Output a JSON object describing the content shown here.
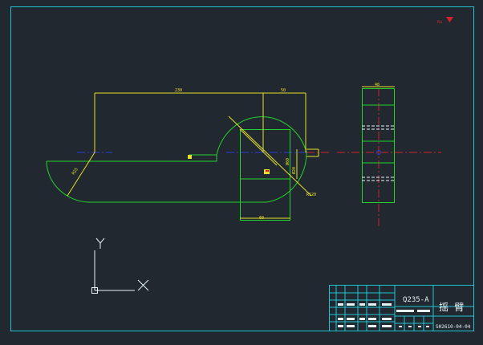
{
  "drawing": {
    "material": "Q235-A",
    "part_name": "摇 臂",
    "drawing_number": "SH2610-04-04",
    "corner_mark": "Ra"
  },
  "dimensions": {
    "overall_length": "230",
    "center_offset": "50",
    "side_width": "48",
    "bore": "Ø60",
    "radius": "R25",
    "vertical": "Ø20",
    "fillet": "R120",
    "bottom": "60"
  },
  "ucs": {
    "x_label": "X",
    "y_label": "Y"
  },
  "colors": {
    "background": "#212830",
    "border": "#1fc4d2",
    "outline": "#22d32b",
    "dimension": "#e8e02a",
    "hidden": "#e6f4f6",
    "centerline_red": "#d2212a",
    "centerline_blue": "#2a3cd6",
    "ucs": "#e6f4f6"
  }
}
